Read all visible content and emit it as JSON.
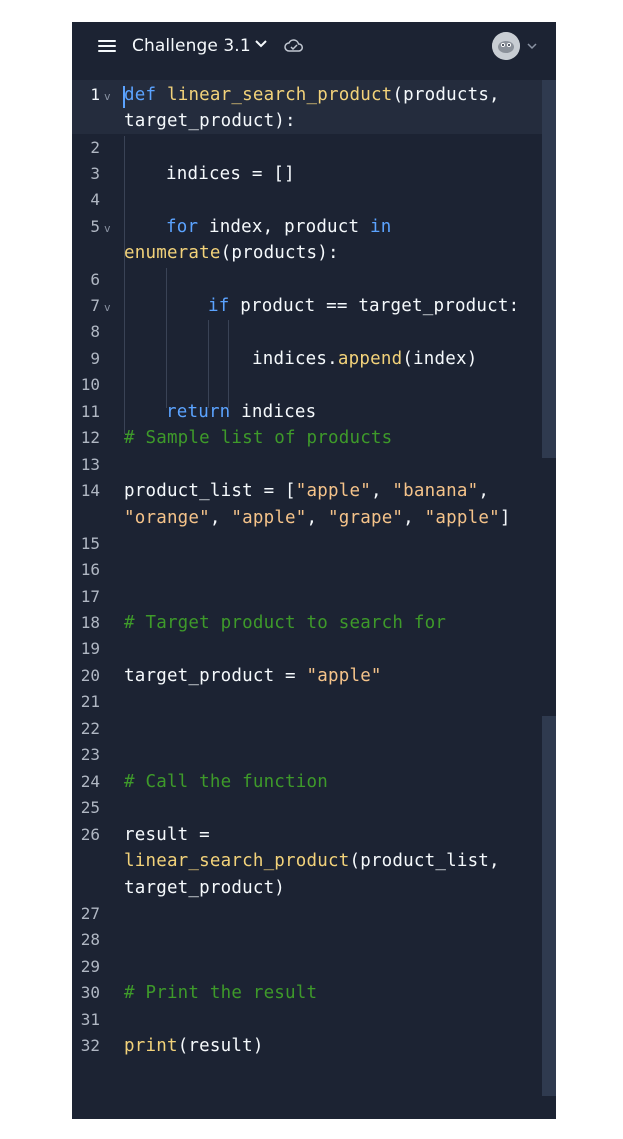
{
  "header": {
    "menu_icon": "hamburger-icon",
    "title": "Challenge 3.1",
    "title_dropdown_icon": "chevron-down-icon",
    "status_icon": "cloud-check-icon",
    "avatar_icon": "user-avatar",
    "avatar_dropdown_icon": "chevron-down-icon"
  },
  "colors": {
    "background": "#1c2333",
    "keyword": "#5ba3ff",
    "function": "#f2d27a",
    "string": "#f5c38a",
    "comment": "#3e9a2a",
    "text": "#f5f9fc",
    "line_number": "#b0b7c3"
  },
  "editor": {
    "line_numbers": [
      "1",
      "2",
      "3",
      "4",
      "5",
      "6",
      "7",
      "8",
      "9",
      "10",
      "11",
      "12",
      "13",
      "14",
      "15",
      "16",
      "17",
      "18",
      "19",
      "20",
      "21",
      "22",
      "23",
      "24",
      "25",
      "26",
      "27",
      "28",
      "29",
      "30",
      "31",
      "32"
    ],
    "active_line": "1",
    "code": {
      "l1_kw": "def",
      "l1_fn": "linear_search_product",
      "l1_rest": "(products,",
      "l1_wrap": "target_product):",
      "l3": "indices = []",
      "l5_kw1": "for",
      "l5_mid": " index, product ",
      "l5_kw2": "in",
      "l5_fn": "enumerate",
      "l5_rest": "(products):",
      "l7_kw": "if",
      "l7_rest": " product == target_product:",
      "l9_a": "indices.",
      "l9_fn": "append",
      "l9_b": "(index)",
      "l11_kw": "return",
      "l11_rest": " indices",
      "l12": "# Sample list of products",
      "l14_a": "product_list = [",
      "l14_s1": "\"apple\"",
      "l14_c1": ", ",
      "l14_s2": "\"banana\"",
      "l14_c2": ",",
      "l14w_s3": "\"orange\"",
      "l14w_c3": ", ",
      "l14w_s4": "\"apple\"",
      "l14w_c4": ", ",
      "l14w_s5": "\"grape\"",
      "l14w_c5": ", ",
      "l14w_s6": "\"apple\"",
      "l14w_end": "]",
      "l18": "# Target product to search for",
      "l20_a": "target_product = ",
      "l20_s": "\"apple\"",
      "l24": "# Call the function",
      "l26": "result =",
      "l26w1_fn": "linear_search_product",
      "l26w1_rest": "(product_list,",
      "l26w2": "target_product)",
      "l30": "# Print the result",
      "l32_fn": "print",
      "l32_rest": "(result)"
    }
  }
}
